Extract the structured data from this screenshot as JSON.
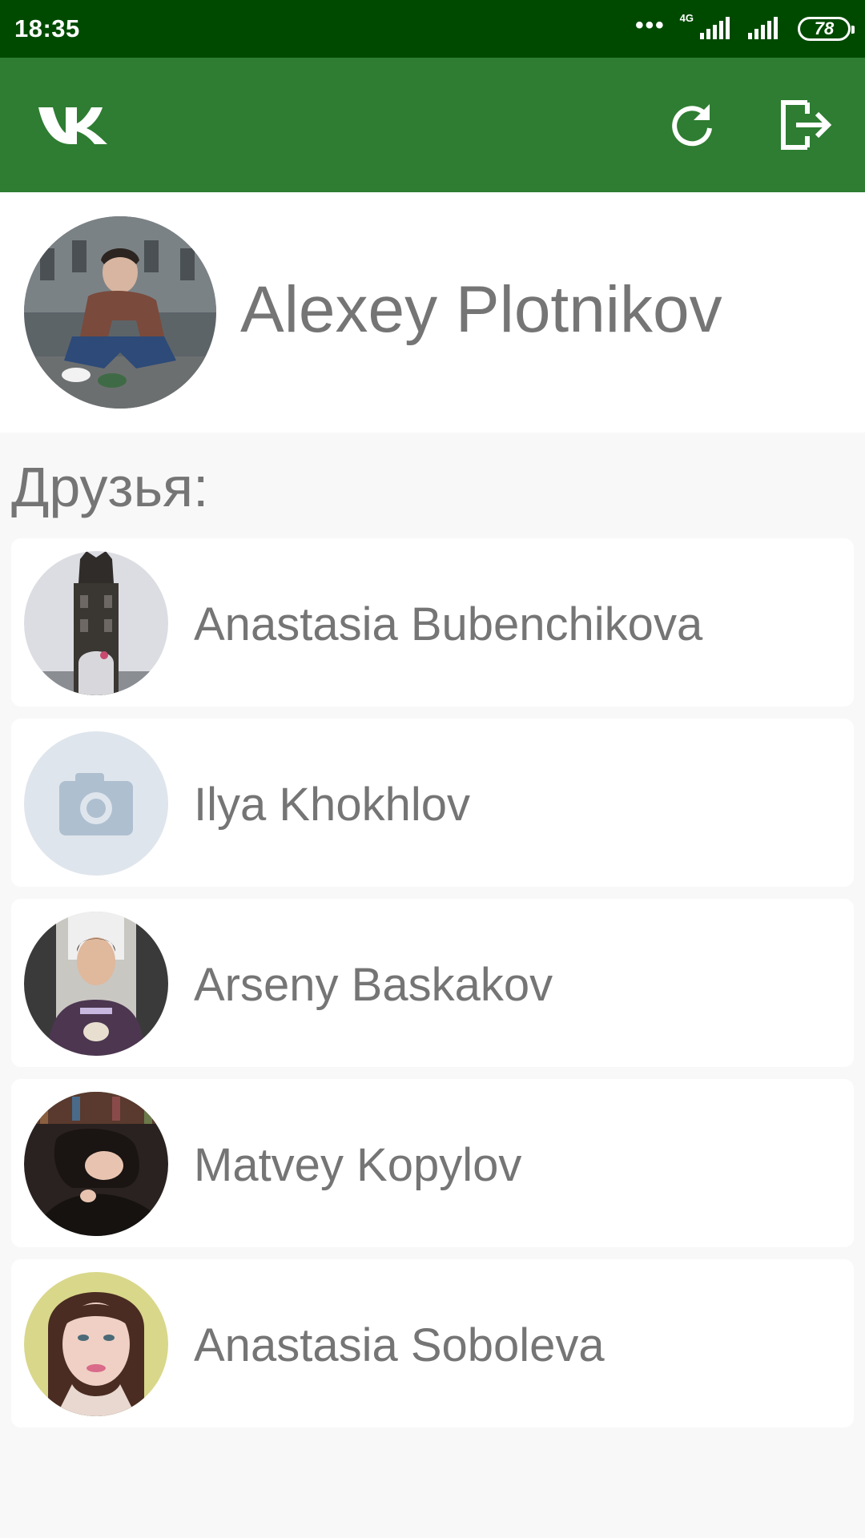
{
  "status_bar": {
    "time": "18:35",
    "dots": "•••",
    "network": "4G",
    "battery": "78"
  },
  "app_bar": {
    "logo_icon": "vk-logo-icon",
    "refresh_icon": "refresh-icon",
    "logout_icon": "logout-icon",
    "color": "#2e7d32",
    "status_color": "#004a00"
  },
  "profile": {
    "name": "Alexey Plotnikov"
  },
  "friends": {
    "title": "Друзья:",
    "items": [
      {
        "name": "Anastasia Bubenchikova"
      },
      {
        "name": "Ilya Khokhlov"
      },
      {
        "name": "Arseny Baskakov"
      },
      {
        "name": "Matvey Kopylov"
      },
      {
        "name": "Anastasia Soboleva"
      }
    ]
  }
}
